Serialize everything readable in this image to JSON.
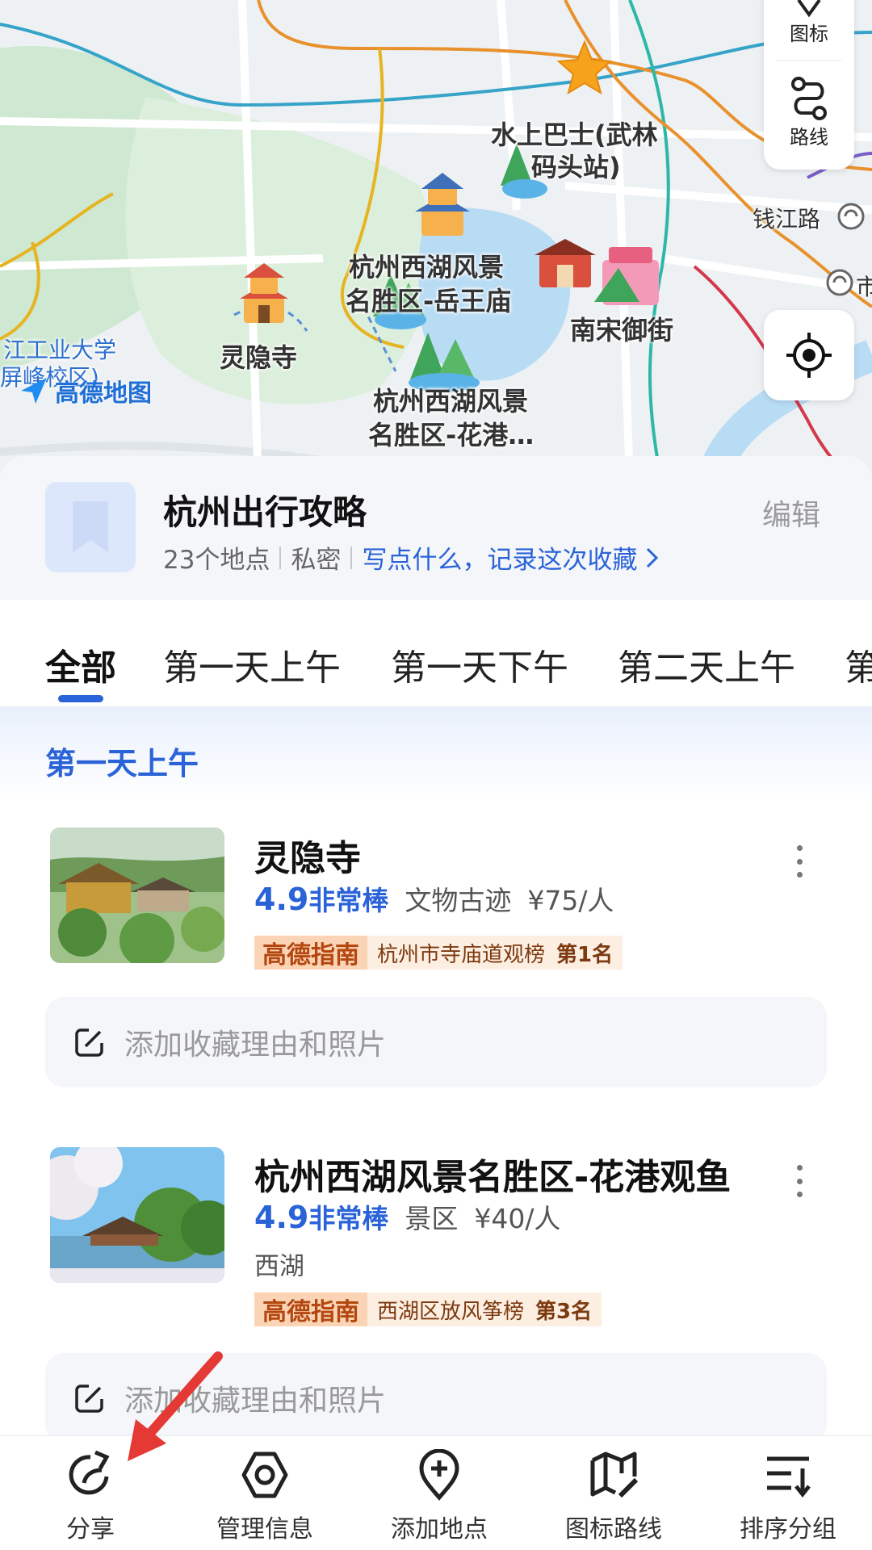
{
  "map": {
    "brand": "高德地图",
    "controls": {
      "icon_label": "图标",
      "route_label": "路线"
    },
    "labels": {
      "water_bus": "水上巴士(武林",
      "water_bus_2": "码头站)",
      "qianjiang_road": "钱江路",
      "lingyin": "灵隐寺",
      "yuewang_1": "杭州西湖风景",
      "yuewang_2": "名胜区-岳王庙",
      "nansong": "南宋御街",
      "huagang_1": "杭州西湖风景",
      "huagang_2": "名胜区-花港…",
      "university_1": "江工业大学",
      "university_2": "屏峰校区)",
      "metro_icon": "市"
    }
  },
  "collection": {
    "title": "杭州出行攻略",
    "edit_label": "编辑",
    "count": "23个地点",
    "privacy": "私密",
    "note_prompt": "写点什么，记录这次收藏"
  },
  "tabs": [
    "全部",
    "第一天上午",
    "第一天下午",
    "第二天上午",
    "第"
  ],
  "group": {
    "title": "第一天上午"
  },
  "items": [
    {
      "name": "灵隐寺",
      "score": "4.9",
      "tag": "非常棒",
      "category": "文物古迹",
      "price": "¥75/人",
      "area": "",
      "rank_brand": "高德指南",
      "rank_list": "杭州市寺庙道观榜",
      "rank_pos": "第1名",
      "reason_placeholder": "添加收藏理由和照片"
    },
    {
      "name": "杭州西湖风景名胜区-花港观鱼",
      "score": "4.9",
      "tag": "非常棒",
      "category": "景区",
      "price": "¥40/人",
      "area": "西湖",
      "rank_brand": "高德指南",
      "rank_list": "西湖区放风筝榜",
      "rank_pos": "第3名",
      "reason_placeholder": "添加收藏理由和照片"
    }
  ],
  "bottom_bar": [
    {
      "label": "分享",
      "icon": "share-icon"
    },
    {
      "label": "管理信息",
      "icon": "hexagon-icon"
    },
    {
      "label": "添加地点",
      "icon": "add-location-icon"
    },
    {
      "label": "图标路线",
      "icon": "map-edit-icon"
    },
    {
      "label": "排序分组",
      "icon": "sort-icon"
    }
  ],
  "colors": {
    "accent": "#2a63d8",
    "rank_brand": "#b3470f",
    "background": "#f4f6f9"
  }
}
